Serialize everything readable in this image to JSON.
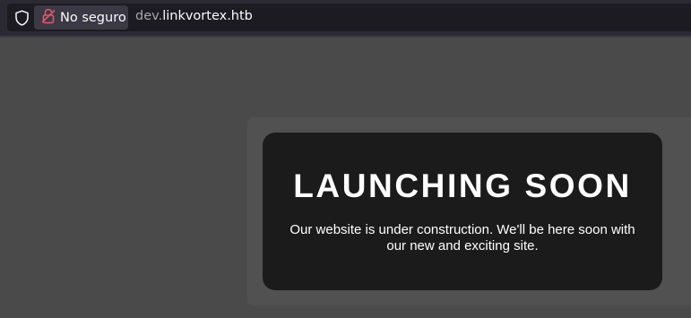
{
  "browser": {
    "security_label": "No seguro",
    "url_subdomain": "dev.",
    "url_domain": "linkvortex.htb"
  },
  "page": {
    "title": "LAUNCHING SOON",
    "message": "Our website is under construction. We'll be here soon with our new and exciting site."
  },
  "colors": {
    "page_background": "#4a4a4a",
    "card_background": "#1b1b1b",
    "insecure_icon": "#e0566a"
  },
  "icons": {
    "tracking_protection": "shield-icon",
    "insecure_connection": "broken-lock-icon"
  }
}
